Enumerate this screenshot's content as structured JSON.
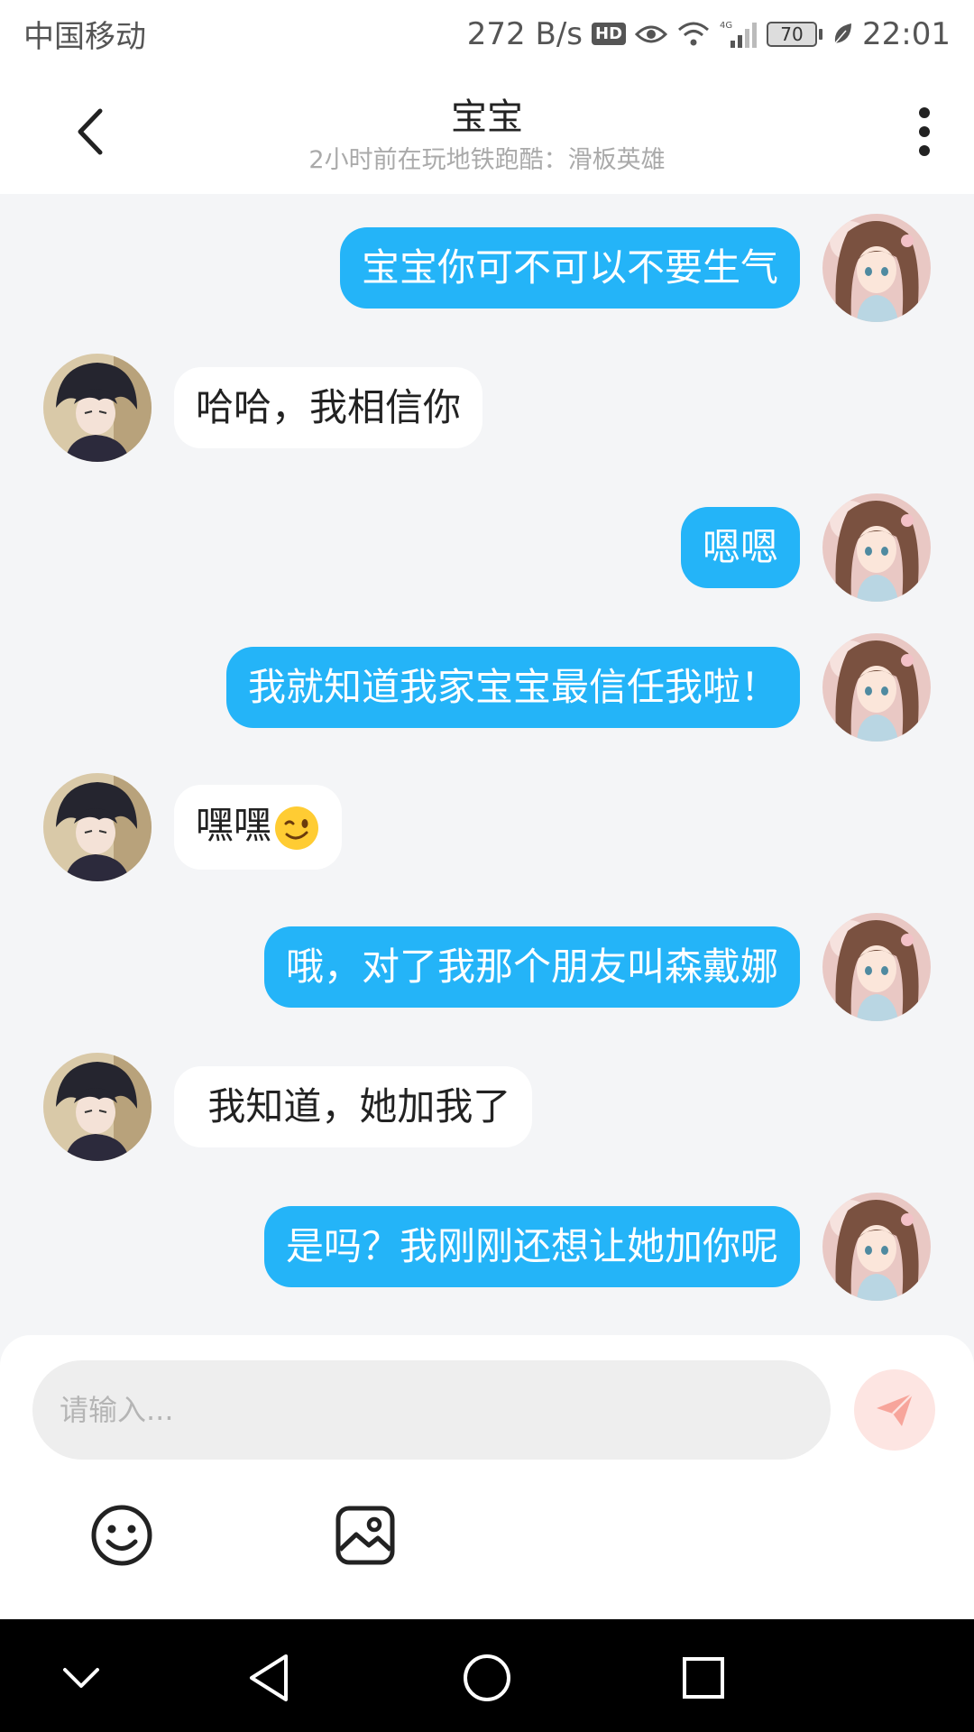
{
  "status_bar": {
    "carrier": "中国移动",
    "net_speed": "272 B/s",
    "hd_label": "HD",
    "network_type": "4G",
    "battery": "70",
    "time": "22:01",
    "icons": [
      "eye-icon",
      "wifi-icon",
      "signal-icon",
      "battery-icon",
      "leaf-icon"
    ]
  },
  "header": {
    "title": "宝宝",
    "status": "2小时前在玩地铁跑酷：滑板英雄",
    "icons": [
      "back-arrow-icon",
      "more-vertical-icon"
    ]
  },
  "messages": [
    {
      "sender": "me",
      "text": "宝宝你可不可以不要生气"
    },
    {
      "sender": "other",
      "text": "哈哈，我相信你"
    },
    {
      "sender": "me",
      "text": "嗯嗯"
    },
    {
      "sender": "me",
      "text": "我就知道我家宝宝最信任我啦！"
    },
    {
      "sender": "other",
      "text": "嘿嘿",
      "emoji": "winking-face-emoji"
    },
    {
      "sender": "me",
      "text": "哦，对了我那个朋友叫森戴娜"
    },
    {
      "sender": "other",
      "text": " 我知道，她加我了"
    },
    {
      "sender": "me",
      "text": "是吗？我刚刚还想让她加你呢"
    }
  ],
  "composer": {
    "placeholder": "请输入...",
    "value": "",
    "icons": [
      "send-icon",
      "emoji-icon",
      "image-icon"
    ]
  },
  "nav_bar": {
    "icons": [
      "hide-keyboard-icon",
      "back-triangle-icon",
      "home-circle-icon",
      "recents-square-icon"
    ]
  },
  "colors": {
    "my_bubble": "#24b4f8",
    "other_bubble": "#ffffff",
    "chat_background": "#f4f5f7",
    "send_button": "#fde5e2",
    "send_icon": "#f7a59b"
  }
}
